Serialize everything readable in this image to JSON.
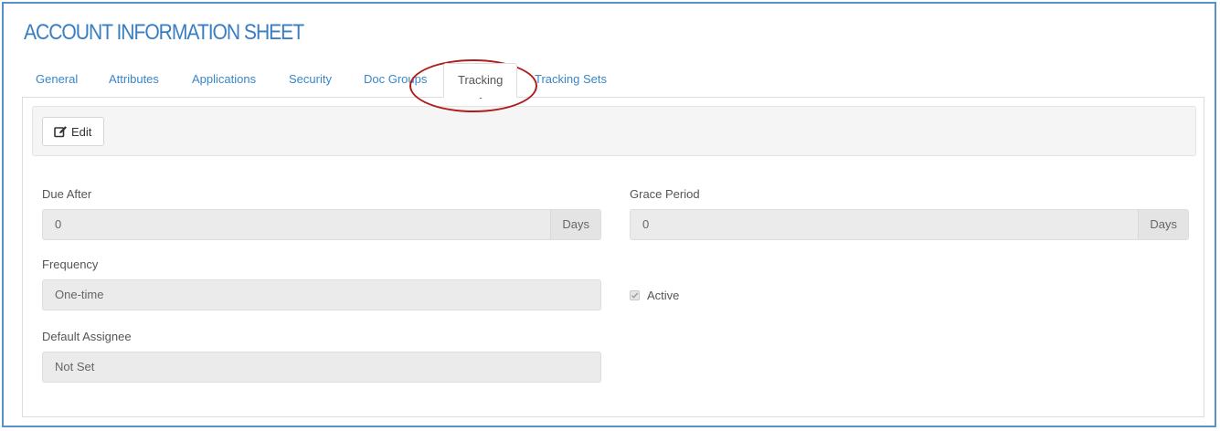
{
  "page": {
    "title": "ACCOUNT INFORMATION SHEET"
  },
  "tabs": [
    {
      "label": "General",
      "active": false
    },
    {
      "label": "Attributes",
      "active": false
    },
    {
      "label": "Applications",
      "active": false
    },
    {
      "label": "Security",
      "active": false
    },
    {
      "label": "Doc Groups",
      "active": false
    },
    {
      "label": "Tracking",
      "active": true
    },
    {
      "label": "Tracking Sets",
      "active": false
    }
  ],
  "toolbar": {
    "edit_label": "Edit",
    "edit_icon": "edit-icon"
  },
  "form": {
    "due_after": {
      "label": "Due After",
      "value": "0",
      "addon": "Days"
    },
    "grace_period": {
      "label": "Grace Period",
      "value": "0",
      "addon": "Days"
    },
    "frequency": {
      "label": "Frequency",
      "value": "One-time"
    },
    "active": {
      "label": "Active",
      "checked": true
    },
    "default_assignee": {
      "label": "Default Assignee",
      "value": "Not Set"
    }
  },
  "colors": {
    "accent": "#3a7ec2",
    "frame_border": "#5b8fc7",
    "annotation": "#b01c1c",
    "field_bg": "#ebebeb"
  }
}
